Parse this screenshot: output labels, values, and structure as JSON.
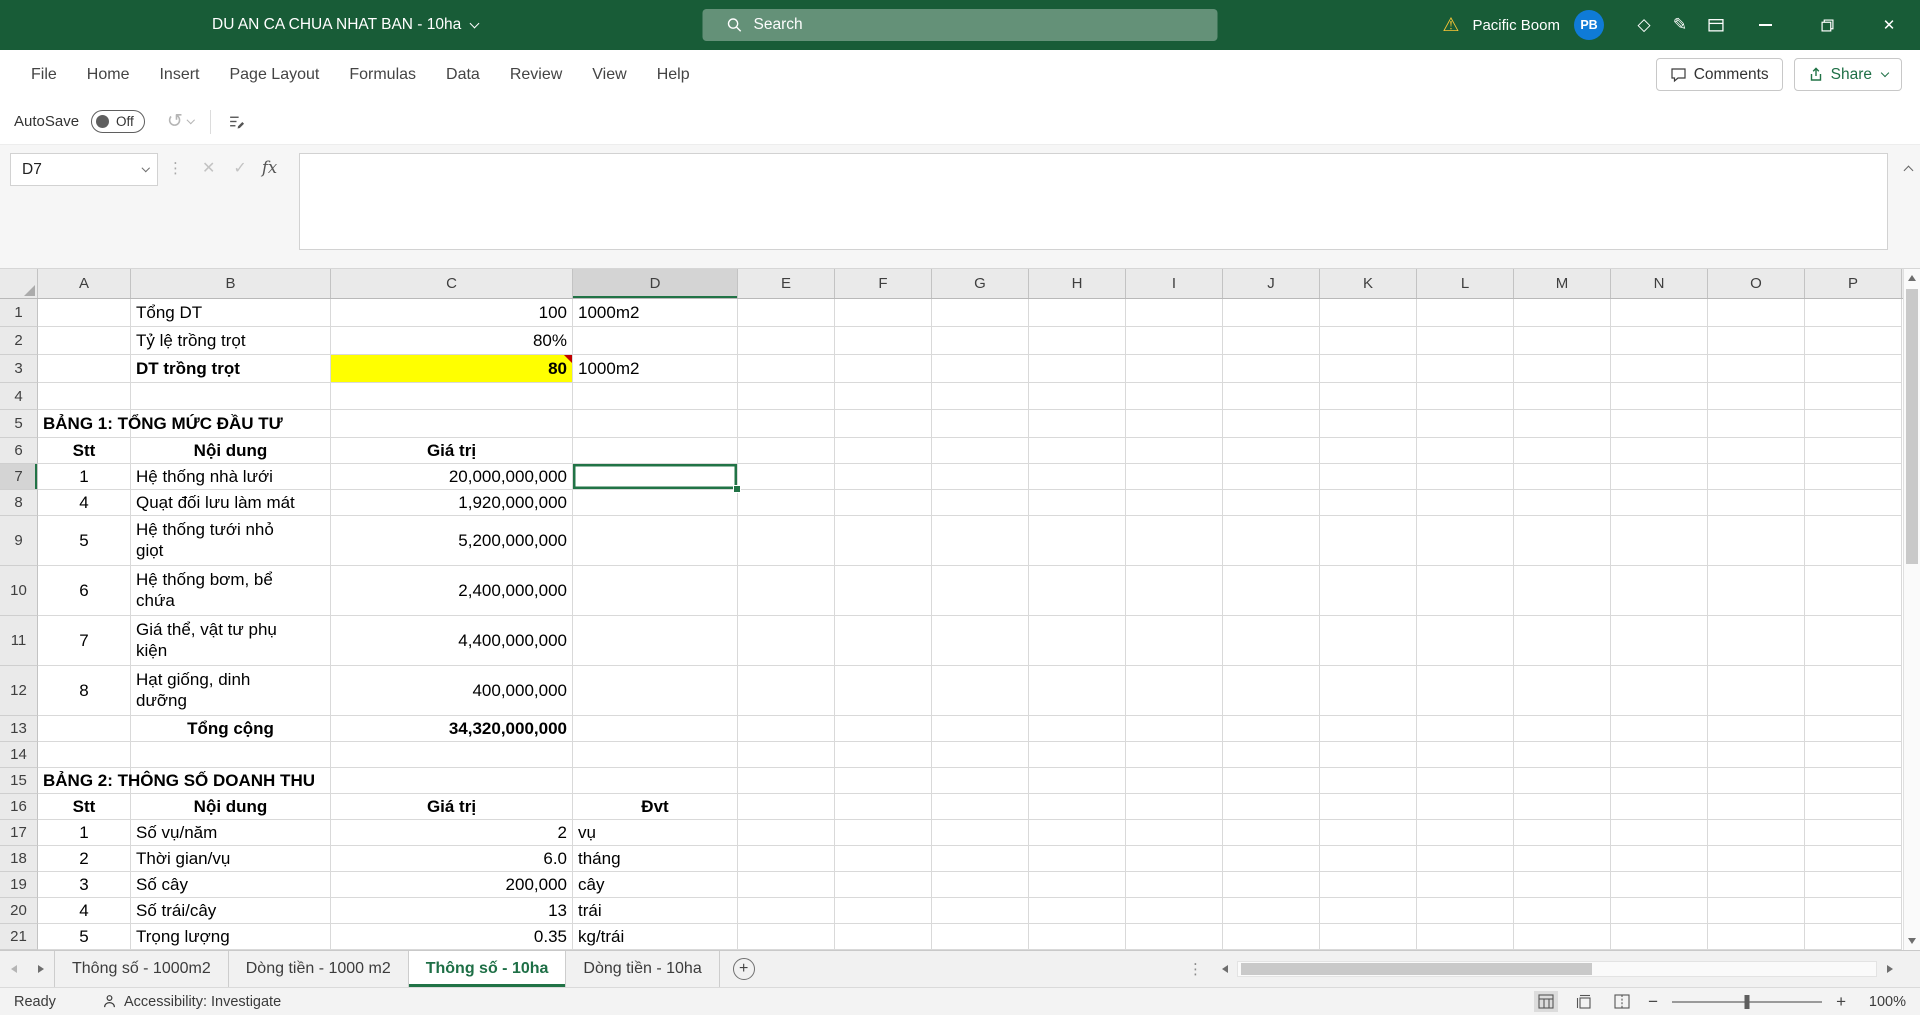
{
  "title_bar": {
    "title": "DU AN CA CHUA NHAT BAN - 10ha",
    "search_placeholder": "Search",
    "user_name": "Pacific Boom",
    "user_initials": "PB"
  },
  "ribbon": {
    "tabs": [
      "File",
      "Home",
      "Insert",
      "Page Layout",
      "Formulas",
      "Data",
      "Review",
      "View",
      "Help"
    ],
    "comments_label": "Comments",
    "share_label": "Share"
  },
  "quick_access": {
    "autosave_label": "AutoSave",
    "autosave_state": "Off"
  },
  "formula_bar": {
    "name_box": "D7",
    "fx_label": "fx",
    "formula": ""
  },
  "colors": {
    "titlebar_green": "#185C37",
    "accent_green": "#217346",
    "highlight_yellow": "#FFFF00",
    "avatar_blue": "#0F7BD7",
    "warning_yellow": "#F8C435",
    "comment_red": "#C00000"
  },
  "grid": {
    "columns": [
      "A",
      "B",
      "C",
      "D",
      "E",
      "F",
      "G",
      "H",
      "I",
      "J",
      "K",
      "L",
      "M",
      "N",
      "O",
      "P"
    ],
    "selection": {
      "col": "D",
      "row": 7
    },
    "rows": [
      {
        "n": 1,
        "cells": {
          "B": {
            "t": "Tổng DT"
          },
          "C": {
            "t": "100",
            "a": "r"
          },
          "D": {
            "t": "1000m2"
          }
        }
      },
      {
        "n": 2,
        "cells": {
          "B": {
            "t": "Tỷ lệ trồng trọt"
          },
          "C": {
            "t": "80%",
            "a": "r"
          }
        }
      },
      {
        "n": 3,
        "cells": {
          "B": {
            "t": "DT trồng trọt",
            "b": true
          },
          "C": {
            "t": "80",
            "a": "r",
            "b": true,
            "bg": "highlight",
            "cm": true
          },
          "D": {
            "t": "1000m2"
          }
        }
      },
      {
        "n": 4,
        "cells": {}
      },
      {
        "n": 5,
        "cells": {
          "A": {
            "t": "BẢNG 1: TỔNG MỨC ĐẦU TƯ",
            "b": true,
            "ov": true
          }
        }
      },
      {
        "n": 6,
        "cells": {
          "A": {
            "t": "Stt",
            "a": "c",
            "b": true
          },
          "B": {
            "t": "Nội dung",
            "a": "c",
            "b": true
          },
          "C": {
            "t": "Giá trị",
            "a": "c",
            "b": true
          }
        }
      },
      {
        "n": 7,
        "cells": {
          "A": {
            "t": "1",
            "a": "c"
          },
          "B": {
            "t": "Hệ thống nhà lưới"
          },
          "C": {
            "t": "20,000,000,000",
            "a": "r"
          }
        }
      },
      {
        "n": 8,
        "cells": {
          "A": {
            "t": "4",
            "a": "c"
          },
          "B": {
            "t": "Quạt đối lưu làm mát"
          },
          "C": {
            "t": "1,920,000,000",
            "a": "r"
          }
        }
      },
      {
        "n": 9,
        "cells": {
          "A": {
            "t": "5",
            "a": "c"
          },
          "B": {
            "t": "Hệ thống tưới nhỏ\ngiọt",
            "wr": true
          },
          "C": {
            "t": "5,200,000,000",
            "a": "r"
          }
        }
      },
      {
        "n": 10,
        "cells": {
          "A": {
            "t": "6",
            "a": "c"
          },
          "B": {
            "t": "Hệ thống bơm, bể\nchứa",
            "wr": true
          },
          "C": {
            "t": "2,400,000,000",
            "a": "r"
          }
        }
      },
      {
        "n": 11,
        "cells": {
          "A": {
            "t": "7",
            "a": "c"
          },
          "B": {
            "t": "Giá thể, vật tư phụ\nkiện",
            "wr": true
          },
          "C": {
            "t": "4,400,000,000",
            "a": "r"
          }
        }
      },
      {
        "n": 12,
        "cells": {
          "A": {
            "t": "8",
            "a": "c"
          },
          "B": {
            "t": "Hạt giống, dinh\ndưỡng",
            "wr": true
          },
          "C": {
            "t": "400,000,000",
            "a": "r"
          }
        }
      },
      {
        "n": 13,
        "cells": {
          "B": {
            "t": "Tổng cộng",
            "a": "c",
            "b": true
          },
          "C": {
            "t": "34,320,000,000",
            "a": "r",
            "b": true
          }
        }
      },
      {
        "n": 14,
        "cells": {}
      },
      {
        "n": 15,
        "cells": {
          "A": {
            "t": "BẢNG 2: THÔNG SỐ DOANH THU",
            "b": true,
            "ov": true
          }
        }
      },
      {
        "n": 16,
        "cells": {
          "A": {
            "t": "Stt",
            "a": "c",
            "b": true
          },
          "B": {
            "t": "Nội dung",
            "a": "c",
            "b": true
          },
          "C": {
            "t": "Giá trị",
            "a": "c",
            "b": true
          },
          "D": {
            "t": "Đvt",
            "a": "c",
            "b": true
          }
        }
      },
      {
        "n": 17,
        "cells": {
          "A": {
            "t": "1",
            "a": "c"
          },
          "B": {
            "t": "Số vụ/năm"
          },
          "C": {
            "t": "2",
            "a": "r"
          },
          "D": {
            "t": "vụ"
          }
        }
      },
      {
        "n": 18,
        "cells": {
          "A": {
            "t": "2",
            "a": "c"
          },
          "B": {
            "t": "Thời gian/vụ"
          },
          "C": {
            "t": "6.0",
            "a": "r"
          },
          "D": {
            "t": "tháng"
          }
        }
      },
      {
        "n": 19,
        "cells": {
          "A": {
            "t": "3",
            "a": "c"
          },
          "B": {
            "t": "Số cây"
          },
          "C": {
            "t": "200,000",
            "a": "r"
          },
          "D": {
            "t": "cây"
          }
        }
      },
      {
        "n": 20,
        "cells": {
          "A": {
            "t": "4",
            "a": "c"
          },
          "B": {
            "t": "Số trái/cây"
          },
          "C": {
            "t": "13",
            "a": "r"
          },
          "D": {
            "t": "trái"
          }
        }
      },
      {
        "n": 21,
        "cells": {
          "A": {
            "t": "5",
            "a": "c"
          },
          "B": {
            "t": "Trọng lượng"
          },
          "C": {
            "t": "0.35",
            "a": "r"
          },
          "D": {
            "t": "kg/trái"
          }
        }
      }
    ]
  },
  "sheet_tabs": {
    "tabs": [
      {
        "label": "Thông số - 1000m2"
      },
      {
        "label": "Dòng tiền - 1000 m2"
      },
      {
        "label": "Thông số - 10ha",
        "active": true
      },
      {
        "label": "Dòng tiền - 10ha"
      }
    ]
  },
  "status_bar": {
    "ready": "Ready",
    "accessibility": "Accessibility: Investigate",
    "zoom": "100%"
  }
}
